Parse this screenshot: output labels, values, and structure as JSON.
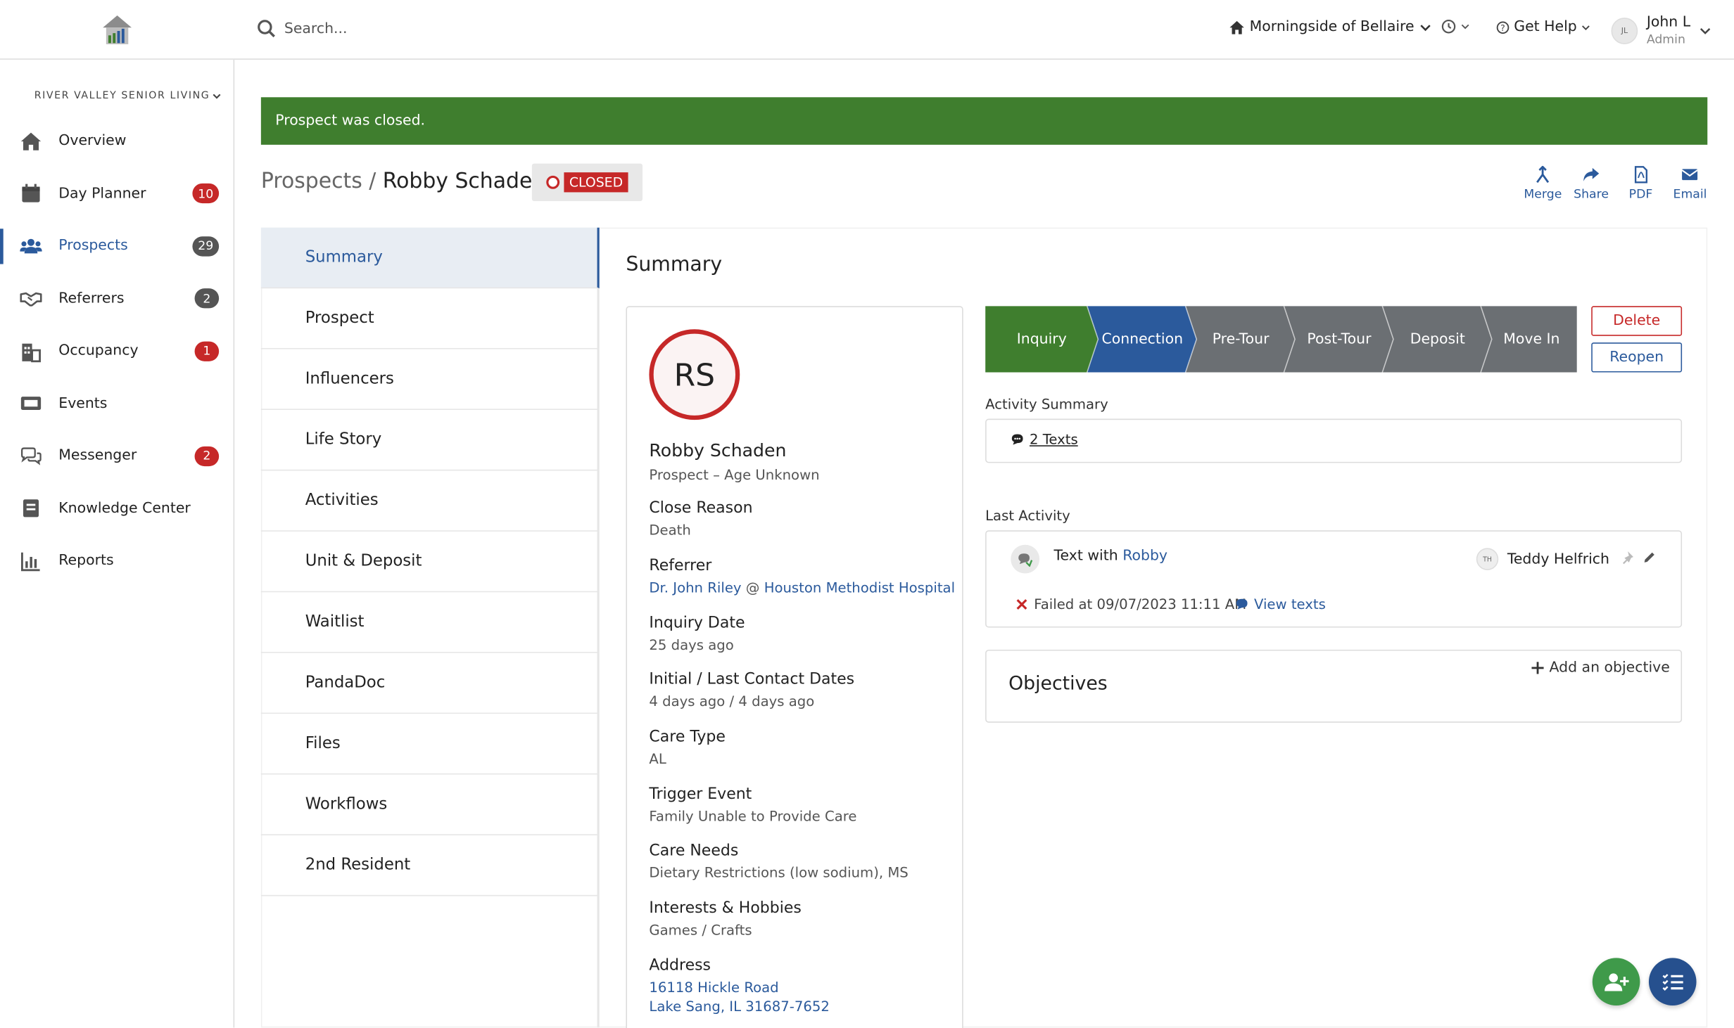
{
  "header": {
    "search_placeholder": "Search...",
    "community": "Morningside of Bellaire",
    "help_label": "Get Help",
    "user_initials": "JL",
    "user_name": "John L",
    "user_role": "Admin"
  },
  "sidebar": {
    "org": "RIVER VALLEY SENIOR LIVING",
    "items": [
      {
        "label": "Overview",
        "badge": null,
        "icon": "home-icon"
      },
      {
        "label": "Day Planner",
        "badge": "10",
        "badge_color": "red",
        "icon": "calendar-icon"
      },
      {
        "label": "Prospects",
        "badge": "29",
        "badge_color": "grey",
        "icon": "users-icon",
        "active": true
      },
      {
        "label": "Referrers",
        "badge": "2",
        "badge_color": "grey",
        "icon": "handshake-icon"
      },
      {
        "label": "Occupancy",
        "badge": "1",
        "badge_color": "red",
        "icon": "building-icon"
      },
      {
        "label": "Events",
        "badge": null,
        "icon": "ticket-icon"
      },
      {
        "label": "Messenger",
        "badge": "2",
        "badge_color": "red",
        "icon": "chat-icon"
      },
      {
        "label": "Knowledge Center",
        "badge": null,
        "icon": "book-icon"
      },
      {
        "label": "Reports",
        "badge": null,
        "icon": "bar-chart-icon"
      }
    ]
  },
  "alert": "Prospect was closed.",
  "breadcrumb": {
    "parent": "Prospects",
    "separator": "/",
    "current": "Robby Schaden"
  },
  "status": "CLOSED",
  "actions": [
    "Merge",
    "Share",
    "PDF",
    "Email"
  ],
  "tabs": [
    "Summary",
    "Prospect",
    "Influencers",
    "Life Story",
    "Activities",
    "Unit & Deposit",
    "Waitlist",
    "PandaDoc",
    "Files",
    "Workflows",
    "2nd Resident"
  ],
  "summary": {
    "title": "Summary",
    "initials": "RS",
    "name": "Robby Schaden",
    "subtitle": "Prospect – Age Unknown",
    "close_reason_label": "Close Reason",
    "close_reason": "Death",
    "referrer_label": "Referrer",
    "referrer_person": "Dr. John Riley",
    "referrer_at": "@",
    "referrer_org": "Houston Methodist Hospital",
    "inquiry_label": "Inquiry Date",
    "inquiry": "25 days ago",
    "contact_label": "Initial / Last Contact Dates",
    "contact": "4 days ago / 4 days ago",
    "care_type_label": "Care Type",
    "care_type": "AL",
    "trigger_label": "Trigger Event",
    "trigger": "Family Unable to Provide Care",
    "care_needs_label": "Care Needs",
    "care_needs": "Dietary Restrictions (low sodium), MS",
    "interests_label": "Interests & Hobbies",
    "interests": "Games / Crafts",
    "address_label": "Address",
    "address_line1": "16118 Hickle Road",
    "address_line2": "Lake Sang, IL 31687-7652"
  },
  "stages": [
    {
      "label": "Inquiry",
      "color": "#3f7e2e"
    },
    {
      "label": "Connection",
      "color": "#2b5a9c"
    },
    {
      "label": "Pre-Tour",
      "color": "#6b6f73"
    },
    {
      "label": "Post-Tour",
      "color": "#6b6f73"
    },
    {
      "label": "Deposit",
      "color": "#6b6f73"
    },
    {
      "label": "Move In",
      "color": "#6b6f73"
    }
  ],
  "buttons": {
    "delete": "Delete",
    "reopen": "Reopen"
  },
  "activity_summary": {
    "label": "Activity Summary",
    "texts": "2 Texts"
  },
  "last_activity": {
    "label": "Last Activity",
    "title_prefix": "Text with",
    "title_name": "Robby",
    "user_initials": "TH",
    "user": "Teddy Helfrich",
    "failed": "Failed at 09/07/2023 11:11 AM",
    "view": "View texts"
  },
  "objectives": {
    "title": "Objectives",
    "add": "Add an objective"
  }
}
